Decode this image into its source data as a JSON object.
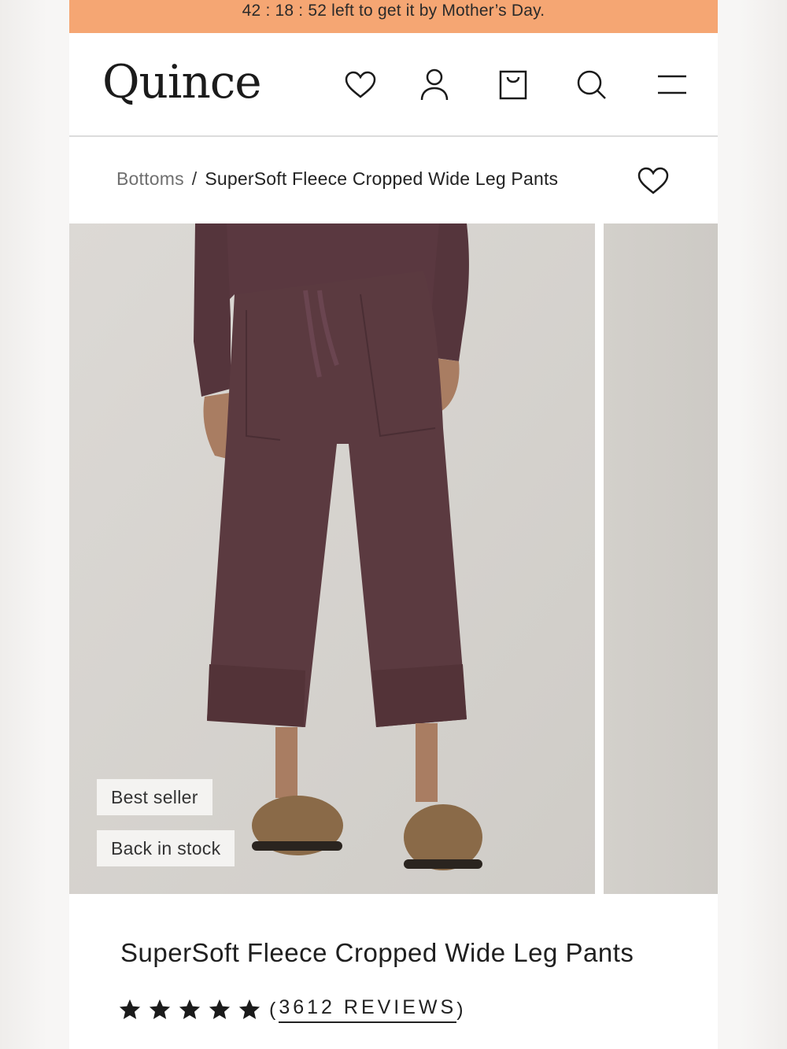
{
  "promo": {
    "text": "42 : 18 : 52 left to get it by Mother’s Day."
  },
  "header": {
    "logo": "Quince",
    "icons": [
      "heart-icon",
      "account-icon",
      "shopping-bag-icon",
      "search-icon",
      "menu-icon"
    ]
  },
  "breadcrumb": {
    "parent": "Bottoms",
    "separator": "/",
    "current": "SuperSoft Fleece Cropped Wide Leg Pants"
  },
  "gallery": {
    "badges": [
      "Best seller",
      "Back in stock"
    ]
  },
  "product": {
    "title": "SuperSoft Fleece Cropped Wide Leg Pants",
    "rating": 5,
    "reviews_open": "(",
    "reviews_label": "3612 REVIEWS",
    "reviews_close": ")"
  },
  "colors": {
    "promo_bg": "#f5a673",
    "pants": "#5b3a40",
    "shoes": "#8a6a48",
    "photo_bg": "#d8d5d1"
  }
}
